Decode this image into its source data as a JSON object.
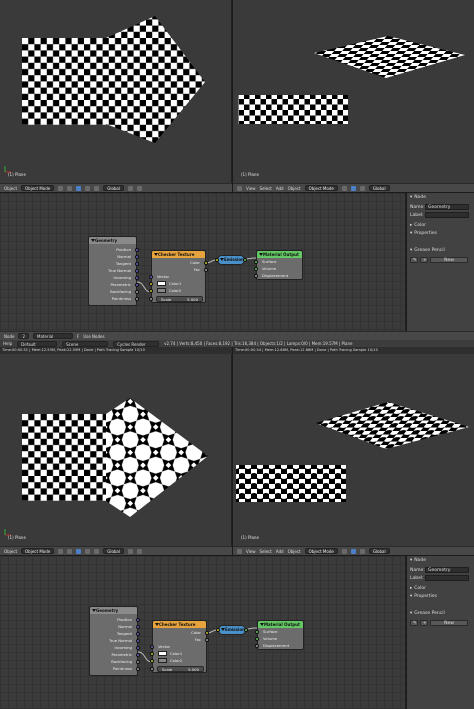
{
  "viewport": {
    "object_label": "(1) Plane"
  },
  "view3d_header": {
    "left_items": [
      "Object"
    ],
    "right_items": [
      "View",
      "Select",
      "Add",
      "Object"
    ],
    "mode": "Object Mode",
    "orientation": "Global"
  },
  "nodes": {
    "geometry": {
      "title": "Geometry",
      "outputs": [
        "Position",
        "Normal",
        "Tangent",
        "True Normal",
        "Incoming",
        "Parametric",
        "Backfacing",
        "Pointiness"
      ]
    },
    "checker": {
      "title": "Checker Texture",
      "out_color": "Color",
      "out_fac": "Fac",
      "in_vector": "Vector",
      "in_color1": "Color1",
      "in_color2": "Color2",
      "scale_label": "Scale",
      "scale_value": "5.000"
    },
    "emission": {
      "title": "Emission"
    },
    "material_output": {
      "title": "Material Output",
      "inputs": [
        "Surface",
        "Volume",
        "Displacement"
      ]
    }
  },
  "node_panel": {
    "section_node": "Node",
    "name_label": "Name:",
    "name_value": "Geometry",
    "label_label": "Label:",
    "section_color": "Color",
    "section_properties": "Properties",
    "section_grease": "Grease Pencil",
    "new_button": "New"
  },
  "node_footer": {
    "items": [
      "Node"
    ],
    "material_slot": "2",
    "material_name": "Material",
    "f_label": "F",
    "use_nodes": "Use Nodes"
  },
  "info_bar": {
    "help": "Help",
    "layout": "Default",
    "scene": "Scene",
    "engine": "Cycles Render",
    "stats": "v2.74 | Verts:8,450 | Faces:8,192 | Tris:16,384 | Objects:1/2 | Lamps:0/0 | Mem:19.57M | Plane"
  },
  "render_status": {
    "left": "Time:00:00.51 | Mem:12.55M, Peak:22.59M | Done | Path Tracing Sample 10/10",
    "right": "Time:00:00.54 | Mem:12.86M, Peak:12.86M | Done | Path Tracing Sample 10/10"
  },
  "colors": {
    "geometry_header": "#8a8a8a",
    "checker_header": "#e6a23c",
    "emission_header": "#4a90c8",
    "output_header": "#63c763"
  }
}
